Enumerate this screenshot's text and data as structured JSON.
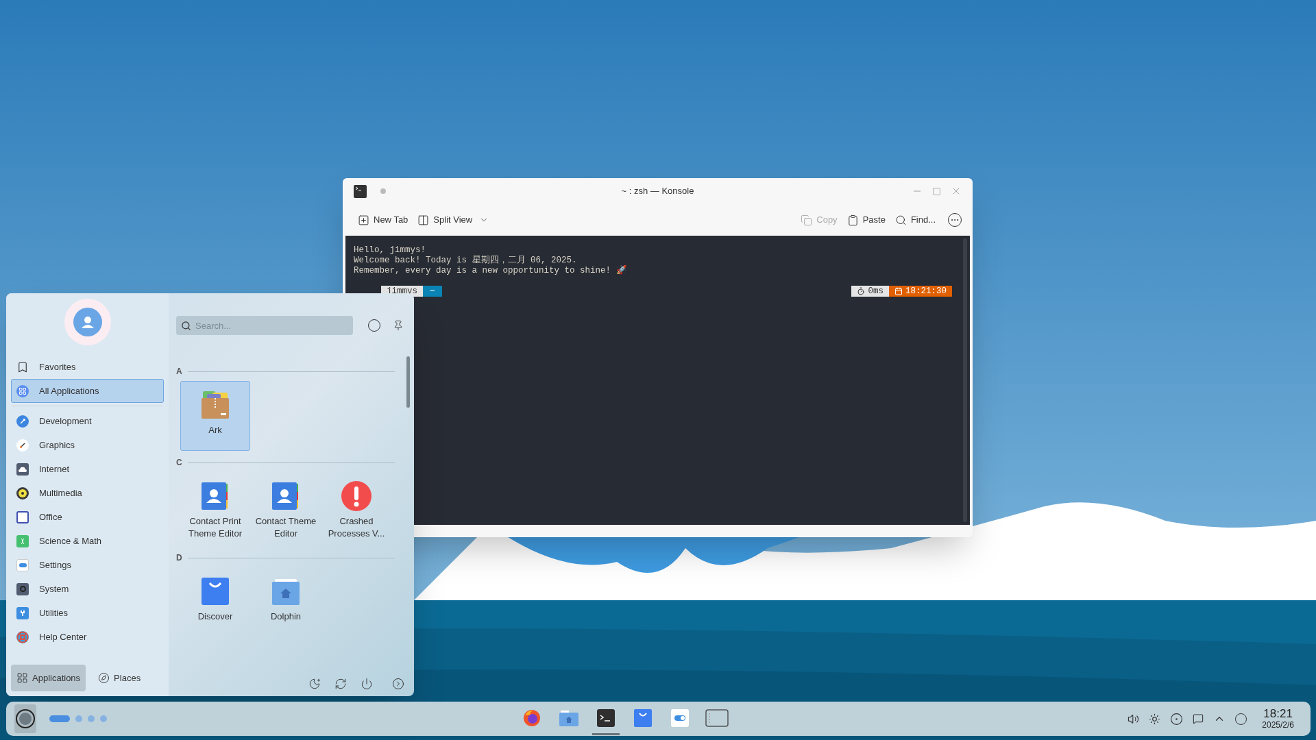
{
  "konsole": {
    "title": "~ : zsh — Konsole",
    "toolbar": [
      {
        "label": "New Tab",
        "disabled": false
      },
      {
        "label": "Split View",
        "disabled": false
      },
      {
        "label": "Copy",
        "disabled": true
      },
      {
        "label": "Paste",
        "disabled": false
      },
      {
        "label": "Find...",
        "disabled": false
      }
    ],
    "terminal_lines": [
      "Hello, jimmys!",
      "Welcome back! Today is 星期四，二月 06, 2025.",
      "Remember, every day is a new opportunity to shine! 🚀"
    ],
    "prompt": {
      "user": "jimmys",
      "path": "~",
      "duration": "0ms",
      "time": "18:21:30"
    }
  },
  "launcher": {
    "search": {
      "placeholder": "Search..."
    },
    "categories": [
      {
        "label": "Favorites",
        "selected": false
      },
      {
        "label": "All Applications",
        "selected": true
      },
      {
        "label": "Development",
        "selected": false
      },
      {
        "label": "Graphics",
        "selected": false
      },
      {
        "label": "Internet",
        "selected": false
      },
      {
        "label": "Multimedia",
        "selected": false
      },
      {
        "label": "Office",
        "selected": false
      },
      {
        "label": "Science & Math",
        "selected": false
      },
      {
        "label": "Settings",
        "selected": false
      },
      {
        "label": "System",
        "selected": false
      },
      {
        "label": "Utilities",
        "selected": false
      },
      {
        "label": "Help Center",
        "selected": false
      }
    ],
    "groups": [
      {
        "letter": "A",
        "apps": [
          {
            "name": "Ark",
            "selected": true
          }
        ]
      },
      {
        "letter": "C",
        "apps": [
          {
            "name": "Contact Print Theme Editor",
            "selected": false
          },
          {
            "name": "Contact Theme Editor",
            "selected": false
          },
          {
            "name": "Crashed Processes V...",
            "selected": false
          }
        ]
      },
      {
        "letter": "D",
        "apps": [
          {
            "name": "Discover",
            "selected": false
          },
          {
            "name": "Dolphin",
            "selected": false
          }
        ]
      }
    ],
    "tabs": [
      {
        "label": "Applications",
        "selected": true
      },
      {
        "label": "Places",
        "selected": false
      }
    ]
  },
  "taskbar": {
    "desktops": [
      {
        "selected": true
      },
      {
        "selected": false
      },
      {
        "selected": false
      },
      {
        "selected": false
      }
    ],
    "tasks": [
      {
        "active": false
      },
      {
        "active": false
      },
      {
        "active": true
      },
      {
        "active": false
      },
      {
        "active": false
      },
      {
        "active": false
      }
    ],
    "clock": {
      "time": "18:21",
      "date": "2025/2/6"
    }
  }
}
